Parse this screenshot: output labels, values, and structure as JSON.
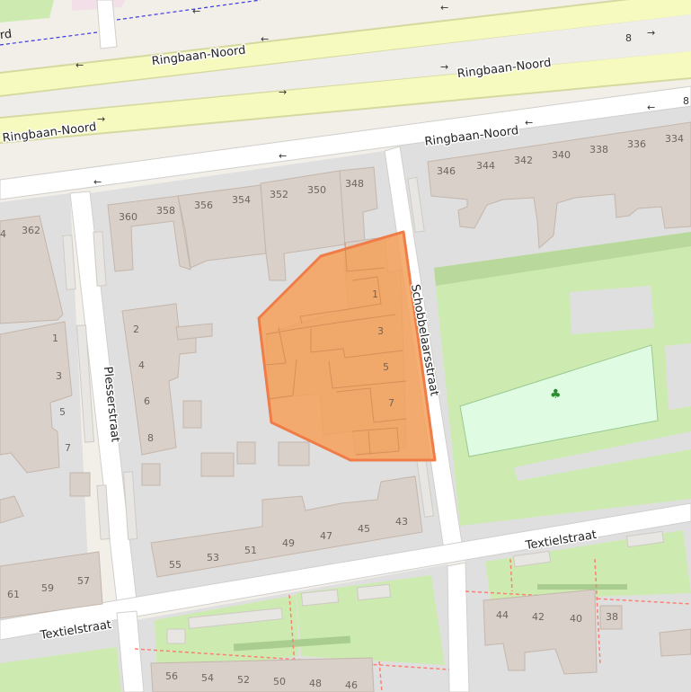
{
  "map": {
    "colors": {
      "land": "#f2efe9",
      "block": "#e0dfdf",
      "road": "#ffffff",
      "primary_road": "#f7fabf",
      "primary_casing": "#d6d99f",
      "building": "#d9d0c9",
      "grass": "#cdebb0",
      "pitch": "#dffce2",
      "highlight_fill": "#f5a15a",
      "highlight_stroke": "#f07d48",
      "path_red": "#fa8072",
      "path_blue": "#3a3ae0"
    },
    "streets": {
      "ringbaan_top_left": "Ringbaan-Noord",
      "ringbaan_top_right": "Ringbaan-Noord",
      "ringbaan_mid_left": "Ringbaan-Noord",
      "ringbaan_service": "Ringbaan-Noord",
      "plesserstraat": "Plesserstraat",
      "schoolbeekstraat": "Schobbelaarsstraat",
      "textielstraat_right": "Textielstraat",
      "textielstraat_left": "Textielstraat",
      "partial_label": "rd"
    },
    "house_numbers": {
      "n362": "362",
      "n360": "360",
      "n358": "358",
      "n356": "356",
      "n354": "354",
      "n352": "352",
      "n350": "350",
      "n348": "348",
      "n346": "346",
      "n344": "344",
      "n342": "342",
      "n340": "340",
      "n338": "338",
      "n336": "336",
      "n334": "334",
      "n4a": "4",
      "n1": "1",
      "n3": "3",
      "n5": "5",
      "n7": "7",
      "n2": "2",
      "n4": "4",
      "n6": "6",
      "n8": "8",
      "h1": "1",
      "h3": "3",
      "h5": "5",
      "h7": "7",
      "n43": "43",
      "n45": "45",
      "n47": "47",
      "n49": "49",
      "n51": "51",
      "n53": "53",
      "n55": "55",
      "n57": "57",
      "n59": "59",
      "n61": "61",
      "n44": "44",
      "n42": "42",
      "n40": "40",
      "n38": "38",
      "n56": "56",
      "n54": "54",
      "n52": "52",
      "n50": "50",
      "n48": "48",
      "n46": "46"
    },
    "symbols": {
      "arrow_left": "←",
      "arrow_right": "→",
      "play_icon": "♣",
      "level_crossing": "8"
    }
  }
}
